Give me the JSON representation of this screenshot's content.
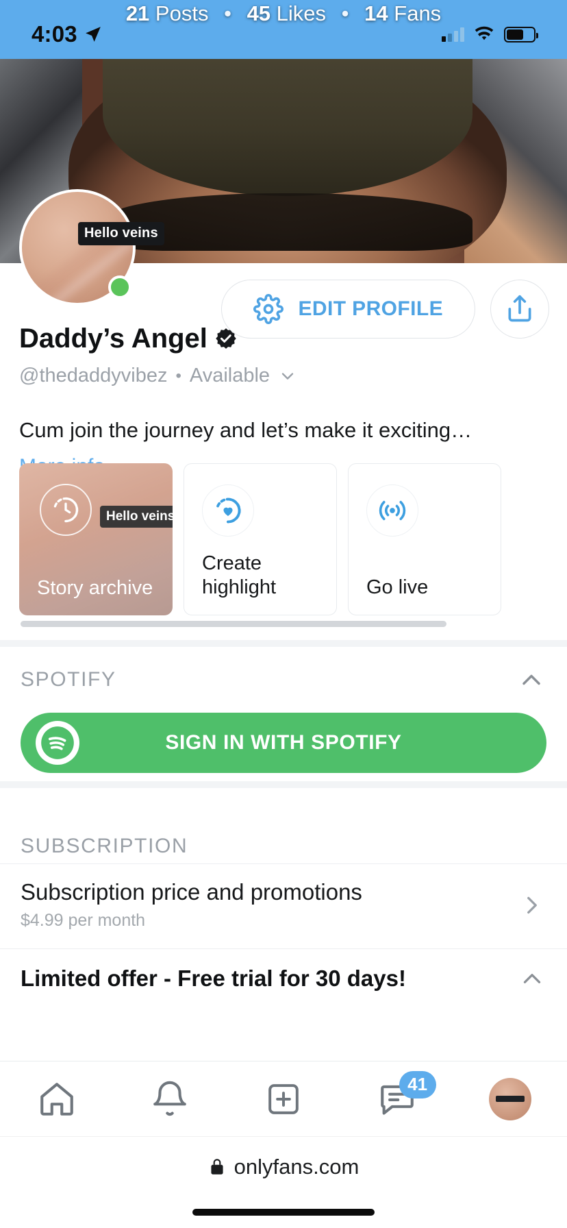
{
  "status_bar": {
    "time": "4:03",
    "location_icon": "location-arrow-icon",
    "signal_icon": "cellular-signal-icon",
    "wifi_icon": "wifi-icon",
    "battery_icon": "battery-icon"
  },
  "cover": {
    "posts_count": "21",
    "posts_label": "Posts",
    "likes_count": "45",
    "likes_label": "Likes",
    "fans_count": "14",
    "fans_label": "Fans",
    "separator": "•"
  },
  "profile": {
    "avatar_tag": "Hello veins",
    "online_status_color": "#5ac45a",
    "display_name": "Daddy’s Angel",
    "verified_icon": "verified-badge-icon",
    "handle": "@thedaddyvibez",
    "separator": "•",
    "availability": "Available",
    "availability_chevron": "chevron-down-icon",
    "bio": "Cum join the journey and let’s make it exciting…",
    "more_info": "More info"
  },
  "actions": {
    "edit_profile_label": "EDIT PROFILE",
    "edit_profile_icon": "gear-icon",
    "share_icon": "share-icon",
    "accent_color": "#4fa3e3"
  },
  "highlight_cards": [
    {
      "label": "Story archive",
      "icon": "story-archive-clock-icon",
      "tag": "Hello veins",
      "type": "photo"
    },
    {
      "label": "Create highlight",
      "icon": "create-highlight-heart-icon",
      "tag": "",
      "type": "plain"
    },
    {
      "label": "Go live",
      "icon": "go-live-broadcast-icon",
      "tag": "",
      "type": "plain"
    }
  ],
  "spotify": {
    "section_title": "SPOTIFY",
    "collapse_icon": "chevron-up-icon",
    "button_label": "SIGN IN WITH SPOTIFY",
    "button_color": "#4fbf6a",
    "logo_icon": "spotify-logo-icon"
  },
  "subscription": {
    "section_title": "SUBSCRIPTION",
    "price_row_title": "Subscription price and promotions",
    "price_row_subtitle": "$4.99 per month",
    "price_row_chevron": "chevron-right-icon",
    "offer_row_title": "Limited offer - Free trial for 30 days!",
    "offer_row_chevron": "chevron-up-icon"
  },
  "bottom_nav": [
    {
      "name": "home",
      "icon": "home-icon",
      "badge": ""
    },
    {
      "name": "notifications",
      "icon": "bell-icon",
      "badge": ""
    },
    {
      "name": "new-post",
      "icon": "plus-square-icon",
      "badge": ""
    },
    {
      "name": "messages",
      "icon": "message-icon",
      "badge": "41"
    },
    {
      "name": "profile",
      "icon": "avatar-icon",
      "badge": ""
    }
  ],
  "browser": {
    "lock_icon": "lock-icon",
    "url": "onlyfans.com"
  }
}
